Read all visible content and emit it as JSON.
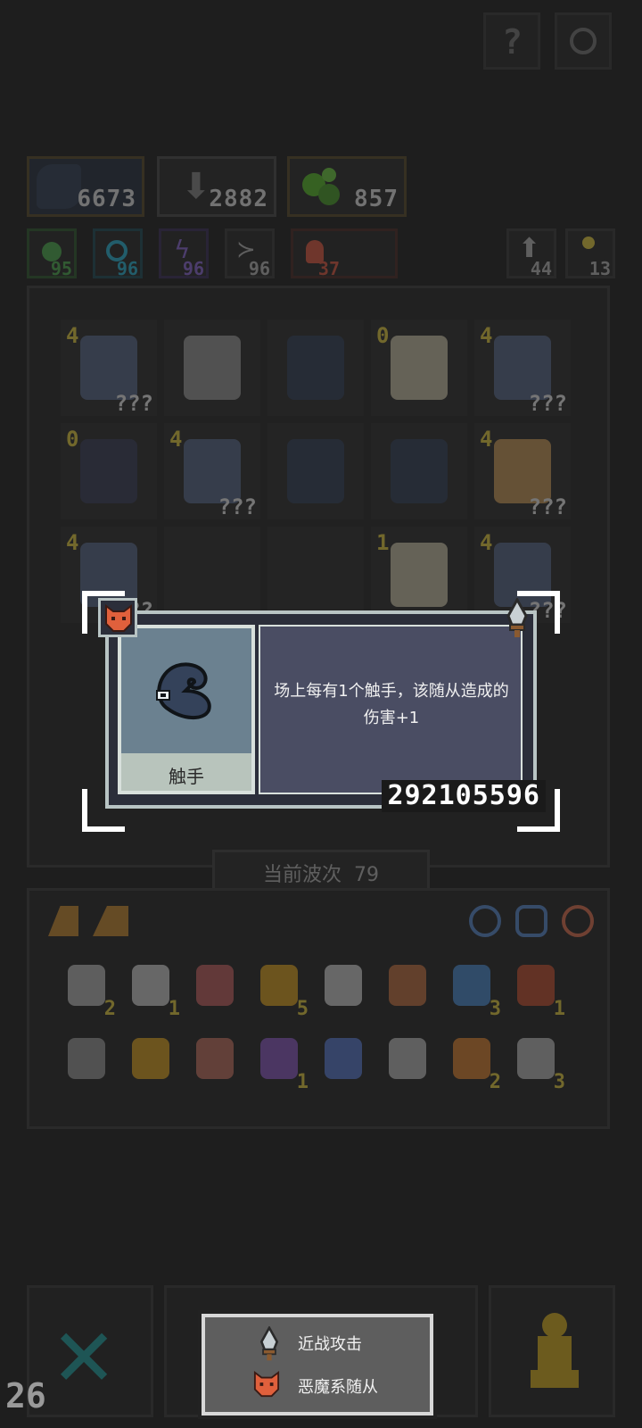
{
  "top_buttons": [
    {
      "icon": "help-icon"
    },
    {
      "icon": "settings-icon"
    }
  ],
  "stats": {
    "tentacle": "6673",
    "attack": "2882",
    "poison": "857"
  },
  "minis_left": [
    {
      "icon": "poison-drop-icon",
      "value": "95",
      "color": "#4caf50"
    },
    {
      "icon": "spiral-icon",
      "value": "96",
      "color": "#29b6d6"
    },
    {
      "icon": "lightning-icon",
      "value": "96",
      "color": "#8e6ad8"
    },
    {
      "icon": "bird-icon",
      "value": "96",
      "color": "#bbbbbb"
    },
    {
      "icon": "fire-icon",
      "value": "37",
      "color": "#e05a40"
    }
  ],
  "minis_right": [
    {
      "icon": "up-arrow-icon",
      "value": "44"
    },
    {
      "icon": "key-icon",
      "value": "13"
    }
  ],
  "grid_cells": [
    {
      "lv": "4",
      "q": "???",
      "unit": "knight"
    },
    {
      "lv": "",
      "q": "",
      "unit": "skeleton"
    },
    {
      "lv": "",
      "q": "",
      "unit": "tentacle"
    },
    {
      "lv": "0",
      "q": "",
      "unit": "demon"
    },
    {
      "lv": "4",
      "q": "???",
      "unit": "knight"
    },
    {
      "lv": "0",
      "q": "",
      "unit": "beast"
    },
    {
      "lv": "4",
      "q": "???",
      "unit": "knight"
    },
    {
      "lv": "",
      "q": "",
      "unit": "tentacle"
    },
    {
      "lv": "",
      "q": "",
      "unit": "tentacle"
    },
    {
      "lv": "4",
      "q": "???",
      "unit": "girl"
    },
    {
      "lv": "4",
      "q": "???",
      "unit": "knight"
    },
    {
      "lv": "",
      "q": "",
      "unit": "empty"
    },
    {
      "lv": "",
      "q": "",
      "unit": "empty"
    },
    {
      "lv": "1",
      "q": "",
      "unit": "demon"
    },
    {
      "lv": "4",
      "q": "???",
      "unit": "knight"
    }
  ],
  "wave": {
    "label": "当前波次",
    "value": "79"
  },
  "tooltip": {
    "name": "触手",
    "description": "场上每有1个触手，该随从造成的伤害+1",
    "damage": "292105596",
    "tag_left_icon": "demon-mask-icon",
    "tag_right_icon": "dagger-icon"
  },
  "item_rows": [
    [
      {
        "icon": "scroll-icon",
        "count": "2"
      },
      {
        "icon": "bone-icon",
        "count": "1"
      },
      {
        "icon": "helmet-icon",
        "count": ""
      },
      {
        "icon": "ring-icon",
        "count": "5"
      },
      {
        "icon": "claws-icon",
        "count": ""
      },
      {
        "icon": "staff-icon",
        "count": ""
      },
      {
        "icon": "orb-icon",
        "count": "3"
      },
      {
        "icon": "axe-icon",
        "count": "1"
      }
    ],
    [
      {
        "icon": "egg-icon",
        "count": ""
      },
      {
        "icon": "wand-icon",
        "count": ""
      },
      {
        "icon": "glove-icon",
        "count": ""
      },
      {
        "icon": "potion-icon",
        "count": "1"
      },
      {
        "icon": "hat-icon",
        "count": ""
      },
      {
        "icon": "box-icon",
        "count": ""
      },
      {
        "icon": "horn-icon",
        "count": "2"
      },
      {
        "icon": "tablet-icon",
        "count": "3"
      }
    ]
  ],
  "legend": [
    {
      "icon": "dagger-icon",
      "label": "近战攻击"
    },
    {
      "icon": "demon-mask-icon",
      "label": "恶魔系随从"
    }
  ],
  "bottom_counter": "26",
  "colors": {
    "tooltip_border": "#b8c4c4",
    "tooltip_body": "#4a4d63",
    "portrait_bg": "#6b8190",
    "name_bg": "#b8c4bc",
    "demon_red": "#e0603c"
  }
}
